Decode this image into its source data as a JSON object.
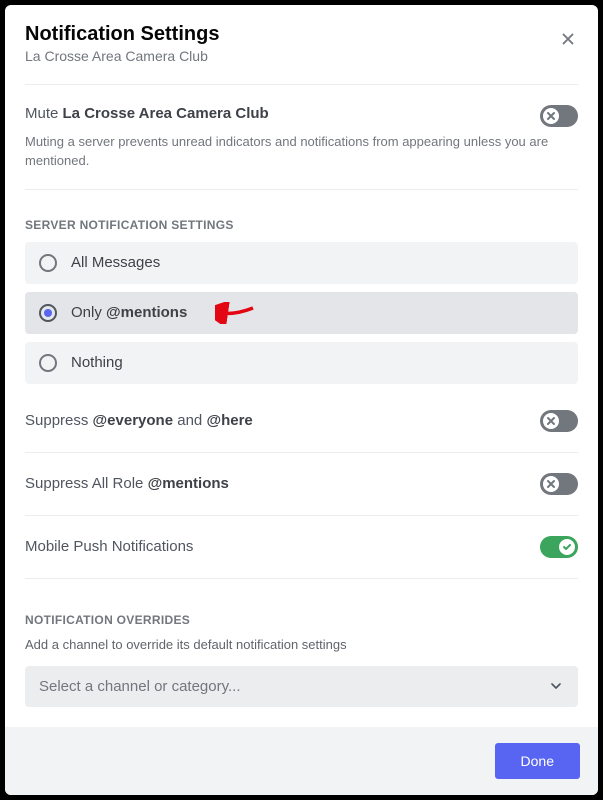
{
  "header": {
    "title": "Notification Settings",
    "subtitle": "La Crosse Area Camera Club"
  },
  "mute": {
    "prefix": "Mute ",
    "target": "La Crosse Area Camera Club",
    "hint": "Muting a server prevents unread indicators and notifications from appearing unless you are mentioned.",
    "value": false
  },
  "server_notif": {
    "heading": "Server Notification Settings",
    "options": [
      {
        "label_plain": "All Messages",
        "selected": false
      },
      {
        "label_prefix": "Only ",
        "label_strong": "@mentions",
        "selected": true
      },
      {
        "label_plain": "Nothing",
        "selected": false
      }
    ]
  },
  "suppress": [
    {
      "pre": "Suppress ",
      "b1": "@everyone",
      "mid": " and ",
      "b2": "@here",
      "value": false
    },
    {
      "pre": "Suppress All Role ",
      "b1": "@mentions",
      "mid": "",
      "b2": "",
      "value": false
    }
  ],
  "mobile_push": {
    "label": "Mobile Push Notifications",
    "value": true
  },
  "overrides": {
    "heading": "Notification Overrides",
    "desc": "Add a channel to override its default notification settings",
    "select_placeholder": "Select a channel or category..."
  },
  "footer": {
    "done": "Done"
  }
}
